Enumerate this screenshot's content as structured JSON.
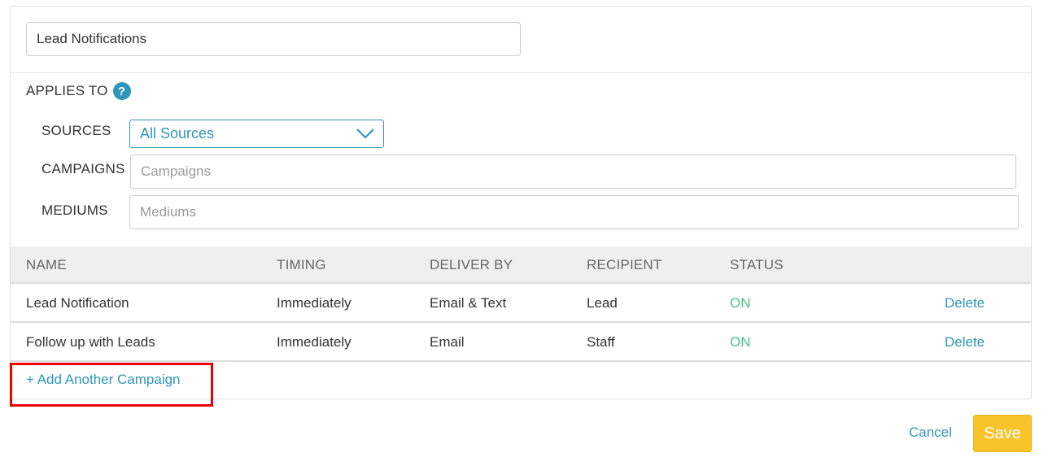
{
  "form": {
    "name_value": "Lead Notifications",
    "applies_to_label": "APPLIES TO",
    "help_icon": "question-circle-icon",
    "sources": {
      "label": "SOURCES",
      "selected": "All Sources"
    },
    "campaigns": {
      "label": "CAMPAIGNS",
      "placeholder": "Campaigns"
    },
    "mediums": {
      "label": "MEDIUMS",
      "placeholder": "Mediums"
    }
  },
  "table": {
    "headers": [
      "NAME",
      "TIMING",
      "DELIVER BY",
      "RECIPIENT",
      "STATUS"
    ],
    "rows": [
      {
        "name": "Lead Notification",
        "timing": "Immediately",
        "deliver_by": "Email & Text",
        "recipient": "Lead",
        "status": "ON",
        "action": "Delete"
      },
      {
        "name": "Follow up with Leads",
        "timing": "Immediately",
        "deliver_by": "Email",
        "recipient": "Staff",
        "status": "ON",
        "action": "Delete"
      }
    ]
  },
  "add_campaign_label": "+ Add Another Campaign",
  "footer": {
    "cancel_label": "Cancel",
    "save_label": "Save"
  },
  "colors": {
    "accent": "#2e96b8",
    "status_on": "#4bc08d",
    "save": "#f9c32a",
    "highlight": "#ee0000"
  }
}
